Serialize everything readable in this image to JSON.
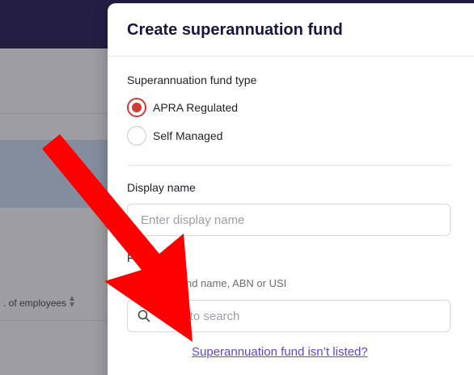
{
  "background": {
    "column_header": ". of employees"
  },
  "modal": {
    "title": "Create superannuation fund",
    "fund_type": {
      "label": "Superannuation fund type",
      "options": [
        {
          "label": "APRA Regulated",
          "checked": true
        },
        {
          "label": "Self Managed",
          "checked": false
        }
      ]
    },
    "display_name": {
      "label": "Display name",
      "placeholder": "Enter display name",
      "value": ""
    },
    "fund": {
      "label": "Fund",
      "help": "Search by fund name, ABN or USI",
      "placeholder": "Type to search",
      "value": ""
    },
    "not_listed_link": "Superannuation fund isn’t listed?"
  },
  "colors": {
    "topbar": "#211654",
    "accent_radio": "#d33b35",
    "link": "#5b46d6",
    "annotation_arrow": "#ff0000"
  },
  "icons": {
    "search": "search-icon",
    "sort": "sort-icon",
    "annotation": "red-arrow"
  }
}
